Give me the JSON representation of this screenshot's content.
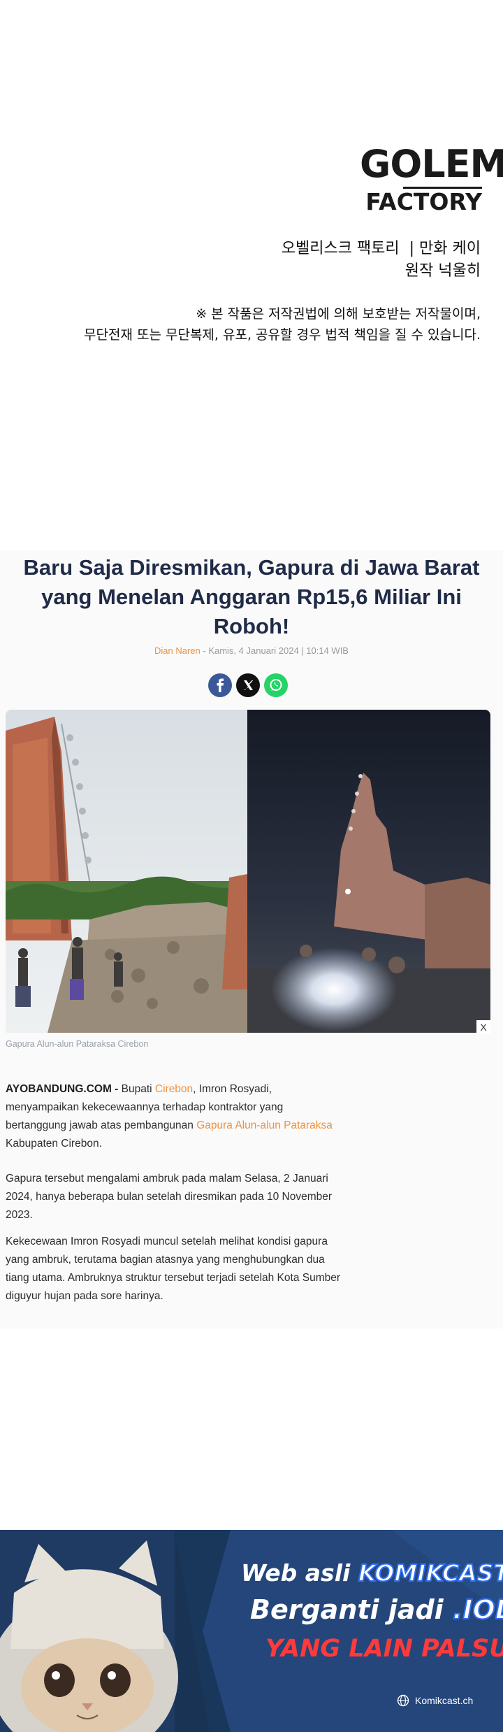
{
  "credits": {
    "logo_line1": "GOLEM",
    "logo_line2": "FACTORY",
    "credit_line1": "오벨리스크 팩토리  | 만화 케이",
    "credit_line2": "원작 넉울히",
    "notice_line1": "※ 본 작품은 저작권법에 의해 보호받는 저작물이며,",
    "notice_line2": "무단전재 또는 무단복제, 유포, 공유할 경우 법적 책임을 질 수 있습니다."
  },
  "article": {
    "headline_line1": "Baru Saja Diresmikan, Gapura di Jawa Barat",
    "headline_line2": "yang Menelan Anggaran Rp15,6 Miliar Ini",
    "headline_line3": "Roboh!",
    "author": "Dian Naren",
    "date": "- Kamis, 4 Januari 2024 | 10:14 WIB",
    "share": {
      "facebook": "facebook-icon",
      "x": "x-icon",
      "whatsapp": "whatsapp-icon"
    },
    "photo_close": "X",
    "caption": "Gapura Alun-alun Pataraksa Cirebon",
    "p1_brand": "AYOBANDUNG.COM -",
    "p1_a": " Bupati ",
    "p1_link1": "Cirebon",
    "p1_b": ", Imron Rosyadi, menyampaikan kekecewaannya terhadap kontraktor yang bertanggung jawab atas pembangunan ",
    "p1_link2": "Gapura Alun-alun Pataraksa",
    "p1_c": " Kabupaten Cirebon.",
    "p2": "Gapura tersebut mengalami ambruk pada malam Selasa, 2 Januari 2024, hanya beberapa bulan setelah diresmikan pada 10 November 2023.",
    "p3": "Kekecewaan Imron Rosyadi muncul setelah melihat kondisi gapura yang ambruk, terutama bagian atasnya yang menghubungkan dua tiang utama. Ambruknya struktur tersebut terjadi setelah Kota Sumber diguyur hujan pada sore harinya."
  },
  "banner": {
    "line1_a": "Web asli ",
    "line1_b": "KOMIKCAST.VIP",
    "line2_a": "Berganti jadi ",
    "line2_b": ".IOL",
    "line3": "YANG LAIN PALSU!",
    "footer": "Komikcast.ch"
  },
  "colors": {
    "accent": "#f0913b",
    "headline": "#202b48",
    "banner_bg": "#1f3a63",
    "warning": "#ff3a3a"
  }
}
